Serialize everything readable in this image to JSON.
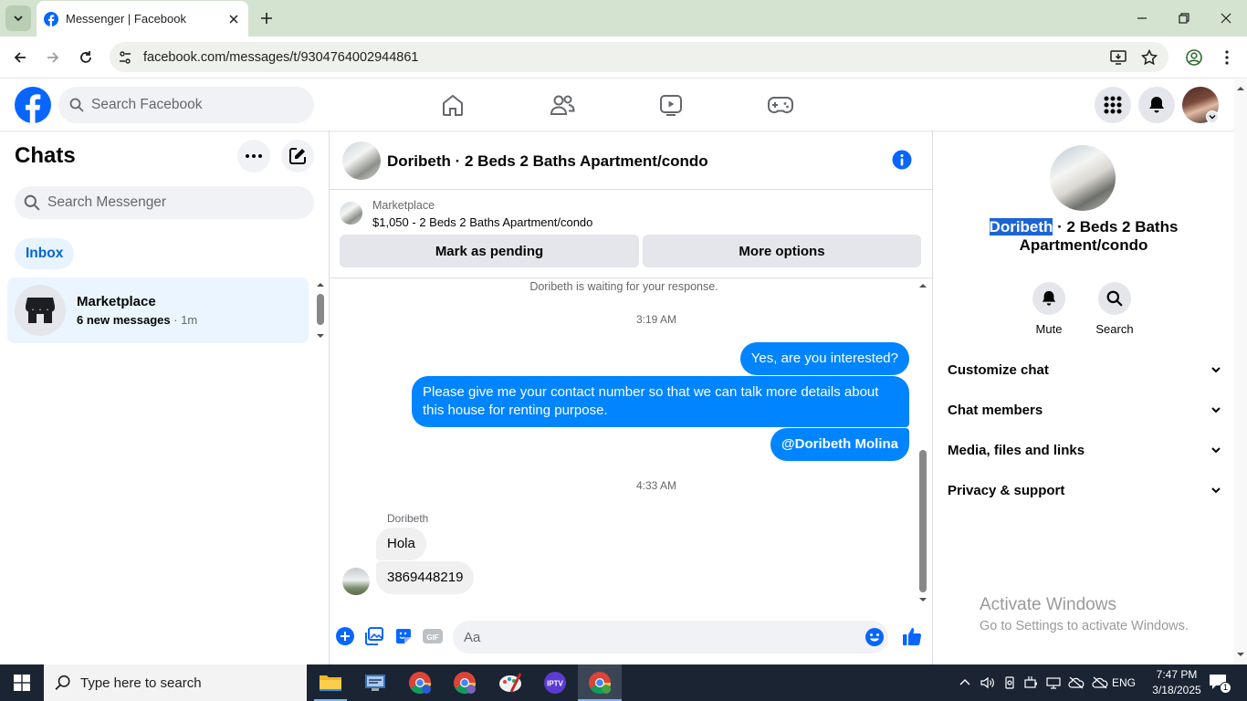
{
  "browser": {
    "tab_title": "Messenger | Facebook",
    "url": "facebook.com/messages/t/9304764002944861"
  },
  "facebook": {
    "search_placeholder": "Search Facebook"
  },
  "chats": {
    "title": "Chats",
    "search_placeholder": "Search Messenger",
    "filter_inbox": "Inbox",
    "items": [
      {
        "name": "Marketplace",
        "preview": "6 new messages",
        "time": " · 1m"
      }
    ]
  },
  "conversation": {
    "title": "Doribeth · 2 Beds 2 Baths Apartment/condo",
    "marketplace_label": "Marketplace",
    "listing": "$1,050 - 2 Beds 2 Baths Apartment/condo",
    "mark_pending": "Mark as pending",
    "more_options": "More options",
    "waiting_notice": "Doribeth is waiting for your response.",
    "time1": "3:19 AM",
    "out1": "Yes, are you interested?",
    "out2": "Please give me your contact number so that we can talk more details about this house for renting purpose.",
    "out3": "@Doribeth Molina",
    "time2": "4:33 AM",
    "sender": "Doribeth",
    "in1": "Hola",
    "in2": "3869448219",
    "composer_placeholder": "Aa"
  },
  "details": {
    "name_highlight": "Doribeth",
    "name_rest": " · 2 Beds 2 Baths Apartment/condo",
    "mute": "Mute",
    "search": "Search",
    "sections": [
      "Customize chat",
      "Chat members",
      "Media, files and links",
      "Privacy & support"
    ]
  },
  "watermark": {
    "line1": "Activate Windows",
    "line2": "Go to Settings to activate Windows."
  },
  "taskbar": {
    "search_placeholder": "Type here to search",
    "language": "ENG",
    "time": "7:47 PM",
    "date": "3/18/2025",
    "notification_count": "1"
  },
  "colors": {
    "facebook_blue": "#0866ff",
    "messenger_bubble": "#0084ff",
    "browser_chrome": "#d3e3cf",
    "taskbar": "#1a2433"
  }
}
